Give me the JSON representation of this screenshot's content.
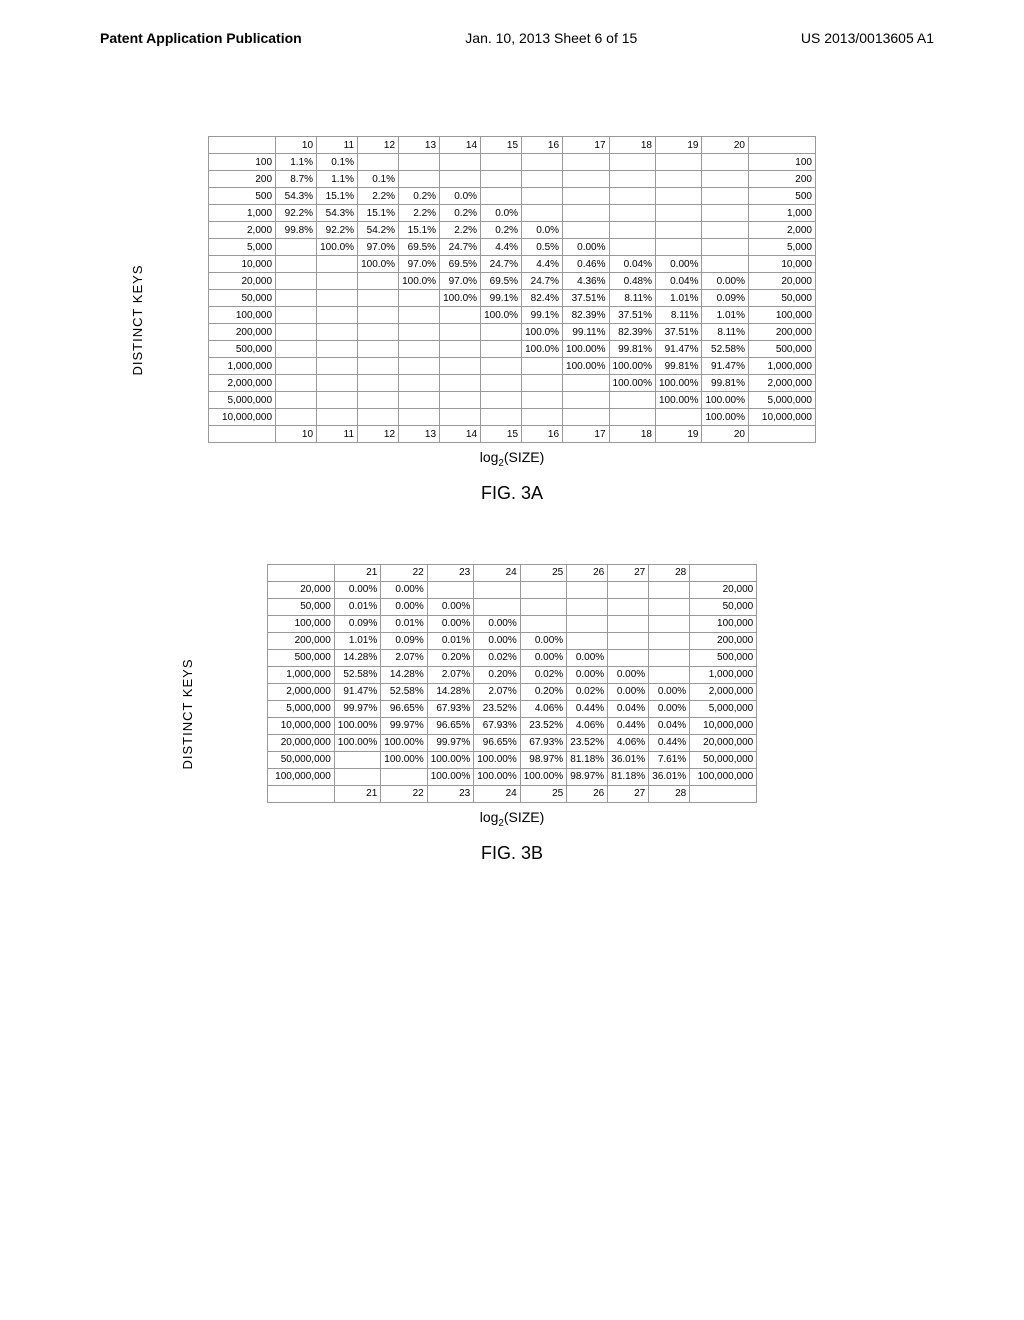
{
  "header": {
    "left": "Patent Application Publication",
    "mid": "Jan. 10, 2013  Sheet 6 of 15",
    "right": "US 2013/0013605 A1"
  },
  "figure_a": {
    "ylabel": "DISTINCT KEYS",
    "xlabel_html": "log₂(SIZE)",
    "caption": "FIG. 3A",
    "col_headers": [
      "10",
      "11",
      "12",
      "13",
      "14",
      "15",
      "16",
      "17",
      "18",
      "19",
      "20"
    ],
    "rows": [
      {
        "k": "100",
        "v": [
          "1.1%",
          "0.1%",
          "",
          "",
          "",
          "",
          "",
          "",
          "",
          "",
          ""
        ]
      },
      {
        "k": "200",
        "v": [
          "8.7%",
          "1.1%",
          "0.1%",
          "",
          "",
          "",
          "",
          "",
          "",
          "",
          ""
        ]
      },
      {
        "k": "500",
        "v": [
          "54.3%",
          "15.1%",
          "2.2%",
          "0.2%",
          "0.0%",
          "",
          "",
          "",
          "",
          "",
          ""
        ]
      },
      {
        "k": "1,000",
        "v": [
          "92.2%",
          "54.3%",
          "15.1%",
          "2.2%",
          "0.2%",
          "0.0%",
          "",
          "",
          "",
          "",
          ""
        ]
      },
      {
        "k": "2,000",
        "v": [
          "99.8%",
          "92.2%",
          "54.2%",
          "15.1%",
          "2.2%",
          "0.2%",
          "0.0%",
          "",
          "",
          "",
          ""
        ]
      },
      {
        "k": "5,000",
        "v": [
          "",
          "100.0%",
          "97.0%",
          "69.5%",
          "24.7%",
          "4.4%",
          "0.5%",
          "0.00%",
          "",
          "",
          ""
        ]
      },
      {
        "k": "10,000",
        "v": [
          "",
          "",
          "100.0%",
          "97.0%",
          "69.5%",
          "24.7%",
          "4.4%",
          "0.46%",
          "0.04%",
          "0.00%",
          ""
        ]
      },
      {
        "k": "20,000",
        "v": [
          "",
          "",
          "",
          "100.0%",
          "97.0%",
          "69.5%",
          "24.7%",
          "4.36%",
          "0.48%",
          "0.04%",
          "0.00%"
        ]
      },
      {
        "k": "50,000",
        "v": [
          "",
          "",
          "",
          "",
          "100.0%",
          "99.1%",
          "82.4%",
          "37.51%",
          "8.11%",
          "1.01%",
          "0.09%"
        ]
      },
      {
        "k": "100,000",
        "v": [
          "",
          "",
          "",
          "",
          "",
          "100.0%",
          "99.1%",
          "82.39%",
          "37.51%",
          "8.11%",
          "1.01%"
        ]
      },
      {
        "k": "200,000",
        "v": [
          "",
          "",
          "",
          "",
          "",
          "",
          "100.0%",
          "99.11%",
          "82.39%",
          "37.51%",
          "8.11%"
        ]
      },
      {
        "k": "500,000",
        "v": [
          "",
          "",
          "",
          "",
          "",
          "",
          "",
          "100.0%",
          "100.00%",
          "99.81%",
          "91.47%",
          "52.58%"
        ],
        "extra": true
      },
      {
        "k": "500,000",
        "v": [
          "",
          "",
          "",
          "",
          "",
          "",
          "100.0%",
          "100.00%",
          "99.81%",
          "91.47%",
          "52.58%"
        ]
      },
      {
        "k": "1,000,000",
        "v": [
          "",
          "",
          "",
          "",
          "",
          "",
          "",
          "100.00%",
          "100.00%",
          "99.81%",
          "91.47%"
        ]
      },
      {
        "k": "2,000,000",
        "v": [
          "",
          "",
          "",
          "",
          "",
          "",
          "",
          "",
          "100.00%",
          "100.00%",
          "99.81%"
        ]
      },
      {
        "k": "5,000,000",
        "v": [
          "",
          "",
          "",
          "",
          "",
          "",
          "",
          "",
          "",
          "100.00%",
          "100.00%"
        ]
      },
      {
        "k": "10,000,000",
        "v": [
          "",
          "",
          "",
          "",
          "",
          "",
          "",
          "",
          "",
          "",
          "100.00%"
        ]
      }
    ],
    "chart_data": {
      "type": "table",
      "title": "FIG. 3A",
      "xlabel": "log2(SIZE)",
      "ylabel": "DISTINCT KEYS",
      "x": [
        10,
        11,
        12,
        13,
        14,
        15,
        16,
        17,
        18,
        19,
        20
      ],
      "y": [
        100,
        200,
        500,
        1000,
        2000,
        5000,
        10000,
        20000,
        50000,
        100000,
        200000,
        500000,
        1000000,
        2000000,
        5000000,
        10000000
      ],
      "values_percent": [
        [
          1.1,
          0.1,
          null,
          null,
          null,
          null,
          null,
          null,
          null,
          null,
          null
        ],
        [
          8.7,
          1.1,
          0.1,
          null,
          null,
          null,
          null,
          null,
          null,
          null,
          null
        ],
        [
          54.3,
          15.1,
          2.2,
          0.2,
          0.0,
          null,
          null,
          null,
          null,
          null,
          null
        ],
        [
          92.2,
          54.3,
          15.1,
          2.2,
          0.2,
          0.0,
          null,
          null,
          null,
          null,
          null
        ],
        [
          99.8,
          92.2,
          54.2,
          15.1,
          2.2,
          0.2,
          0.0,
          null,
          null,
          null,
          null
        ],
        [
          null,
          100.0,
          97.0,
          69.5,
          24.7,
          4.4,
          0.5,
          0.0,
          null,
          null,
          null
        ],
        [
          null,
          null,
          100.0,
          97.0,
          69.5,
          24.7,
          4.4,
          0.46,
          0.04,
          0.0,
          null
        ],
        [
          null,
          null,
          null,
          100.0,
          97.0,
          69.5,
          24.7,
          4.36,
          0.48,
          0.04,
          0.0
        ],
        [
          null,
          null,
          null,
          null,
          100.0,
          99.1,
          82.4,
          37.51,
          8.11,
          1.01,
          0.09
        ],
        [
          null,
          null,
          null,
          null,
          null,
          100.0,
          99.1,
          82.39,
          37.51,
          8.11,
          1.01
        ],
        [
          null,
          null,
          null,
          null,
          null,
          null,
          100.0,
          99.11,
          82.39,
          37.51,
          8.11
        ],
        [
          null,
          null,
          null,
          null,
          null,
          null,
          100.0,
          100.0,
          99.81,
          91.47,
          52.58
        ],
        [
          null,
          null,
          null,
          null,
          null,
          null,
          null,
          100.0,
          100.0,
          99.81,
          91.47
        ],
        [
          null,
          null,
          null,
          null,
          null,
          null,
          null,
          null,
          100.0,
          100.0,
          99.81
        ],
        [
          null,
          null,
          null,
          null,
          null,
          null,
          null,
          null,
          null,
          100.0,
          100.0
        ],
        [
          null,
          null,
          null,
          null,
          null,
          null,
          null,
          null,
          null,
          null,
          100.0
        ]
      ]
    }
  },
  "figure_b": {
    "ylabel": "DISTINCT KEYS",
    "xlabel_html": "log₂(SIZE)",
    "caption": "FIG. 3B",
    "col_headers": [
      "21",
      "22",
      "23",
      "24",
      "25",
      "26",
      "27",
      "28"
    ],
    "rows": [
      {
        "k": "20,000",
        "v": [
          "0.00%",
          "0.00%",
          "",
          "",
          "",
          "",
          "",
          ""
        ]
      },
      {
        "k": "50,000",
        "v": [
          "0.01%",
          "0.00%",
          "0.00%",
          "",
          "",
          "",
          "",
          ""
        ]
      },
      {
        "k": "100,000",
        "v": [
          "0.09%",
          "0.01%",
          "0.00%",
          "0.00%",
          "",
          "",
          "",
          ""
        ]
      },
      {
        "k": "200,000",
        "v": [
          "1.01%",
          "0.09%",
          "0.01%",
          "0.00%",
          "0.00%",
          "",
          "",
          ""
        ]
      },
      {
        "k": "500,000",
        "v": [
          "14.28%",
          "2.07%",
          "0.20%",
          "0.02%",
          "0.00%",
          "0.00%",
          "",
          ""
        ]
      },
      {
        "k": "1,000,000",
        "v": [
          "52.58%",
          "14.28%",
          "2.07%",
          "0.20%",
          "0.02%",
          "0.00%",
          "0.00%",
          ""
        ]
      },
      {
        "k": "2,000,000",
        "v": [
          "91.47%",
          "52.58%",
          "14.28%",
          "2.07%",
          "0.20%",
          "0.02%",
          "0.00%",
          "0.00%"
        ]
      },
      {
        "k": "5,000,000",
        "v": [
          "99.97%",
          "96.65%",
          "67.93%",
          "23.52%",
          "4.06%",
          "0.44%",
          "0.04%",
          "0.00%"
        ]
      },
      {
        "k": "10,000,000",
        "v": [
          "100.00%",
          "99.97%",
          "96.65%",
          "67.93%",
          "23.52%",
          "4.06%",
          "0.44%",
          "0.04%"
        ]
      },
      {
        "k": "20,000,000",
        "v": [
          "100.00%",
          "100.00%",
          "99.97%",
          "96.65%",
          "67.93%",
          "23.52%",
          "4.06%",
          "0.44%"
        ]
      },
      {
        "k": "50,000,000",
        "v": [
          "",
          "100.00%",
          "100.00%",
          "100.00%",
          "98.97%",
          "81.18%",
          "36.01%",
          "7.61%"
        ]
      },
      {
        "k": "100,000,000",
        "v": [
          "",
          "",
          "100.00%",
          "100.00%",
          "100.00%",
          "98.97%",
          "81.18%",
          "36.01%"
        ]
      }
    ],
    "chart_data": {
      "type": "table",
      "title": "FIG. 3B",
      "xlabel": "log2(SIZE)",
      "ylabel": "DISTINCT KEYS",
      "x": [
        21,
        22,
        23,
        24,
        25,
        26,
        27,
        28
      ],
      "y": [
        20000,
        50000,
        100000,
        200000,
        500000,
        1000000,
        2000000,
        5000000,
        10000000,
        20000000,
        50000000,
        100000000
      ],
      "values_percent": [
        [
          0.0,
          0.0,
          null,
          null,
          null,
          null,
          null,
          null
        ],
        [
          0.01,
          0.0,
          0.0,
          null,
          null,
          null,
          null,
          null
        ],
        [
          0.09,
          0.01,
          0.0,
          0.0,
          null,
          null,
          null,
          null
        ],
        [
          1.01,
          0.09,
          0.01,
          0.0,
          0.0,
          null,
          null,
          null
        ],
        [
          14.28,
          2.07,
          0.2,
          0.02,
          0.0,
          0.0,
          null,
          null
        ],
        [
          52.58,
          14.28,
          2.07,
          0.2,
          0.02,
          0.0,
          0.0,
          null
        ],
        [
          91.47,
          52.58,
          14.28,
          2.07,
          0.2,
          0.02,
          0.0,
          0.0
        ],
        [
          99.97,
          96.65,
          67.93,
          23.52,
          4.06,
          0.44,
          0.04,
          0.0
        ],
        [
          100.0,
          99.97,
          96.65,
          67.93,
          23.52,
          4.06,
          0.44,
          0.04
        ],
        [
          100.0,
          100.0,
          99.97,
          96.65,
          67.93,
          23.52,
          4.06,
          0.44
        ],
        [
          null,
          100.0,
          100.0,
          100.0,
          98.97,
          81.18,
          36.01,
          7.61
        ],
        [
          null,
          null,
          100.0,
          100.0,
          100.0,
          98.97,
          81.18,
          36.01
        ]
      ]
    }
  }
}
